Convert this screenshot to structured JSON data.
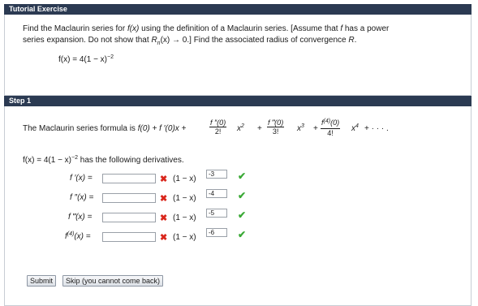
{
  "tutorial": {
    "header": "Tutorial Exercise",
    "q_line1_a": "Find the Maclaurin series for ",
    "q_fx": "f(x)",
    "q_line1_b": " using the definition of a Maclaurin series. [Assume that ",
    "q_f": "f",
    "q_line1_c": " has a power",
    "q_line2_a": "series expansion. Do not show that ",
    "q_R": "R",
    "q_n": "n",
    "q_line2_b": "(x) → 0.] Find the associated radius of convergence ",
    "q_R2": "R",
    "q_line2_c": ".",
    "function_base": "f(x) = 4(1 − x)",
    "function_exp": "−2"
  },
  "step1": {
    "header": "Step 1",
    "formula_intro": "The Maclaurin series formula is ",
    "formula_start": "f(0) + f ′(0)x + ",
    "f2_num": "f ″(0)",
    "f2_den": "2!",
    "f3_num": "f ‴(0)",
    "f3_den": "3!",
    "f4_num_a": "f",
    "f4_num_sup": "(4)",
    "f4_num_b": "(0)",
    "f4_den": "4!",
    "x_var": "x",
    "x2_exp": "2",
    "x3_exp": "3",
    "x4_exp": "4",
    "plus": "+",
    "ellipsis": "+ · · · .",
    "deriv_intro_base": "f(x) = 4(1 − x)",
    "deriv_intro_exp": "−2",
    "deriv_intro_tail": " has the following derivatives.",
    "derivatives": [
      {
        "label": "f ′(x)  =",
        "input_value": "",
        "factor": "(1 − x)",
        "exponent": "-3"
      },
      {
        "label": "f ″(x)  =",
        "input_value": "",
        "factor": "(1 − x)",
        "exponent": "-4"
      },
      {
        "label": "f ‴(x)  =",
        "input_value": "",
        "factor": "(1 − x)",
        "exponent": "-5"
      },
      {
        "label_a": "f",
        "label_sup": "(4)",
        "label_b": "(x)  =",
        "input_value": "",
        "factor": "(1 − x)",
        "exponent": "-6"
      }
    ],
    "submit_label": "Submit",
    "skip_label": "Skip (you cannot come back)"
  },
  "colors": {
    "header_bg": "#2b3a52",
    "wrong": "#d9261c",
    "correct": "#3aa935"
  },
  "icons": {
    "wrong": "✖",
    "correct": "✔"
  }
}
